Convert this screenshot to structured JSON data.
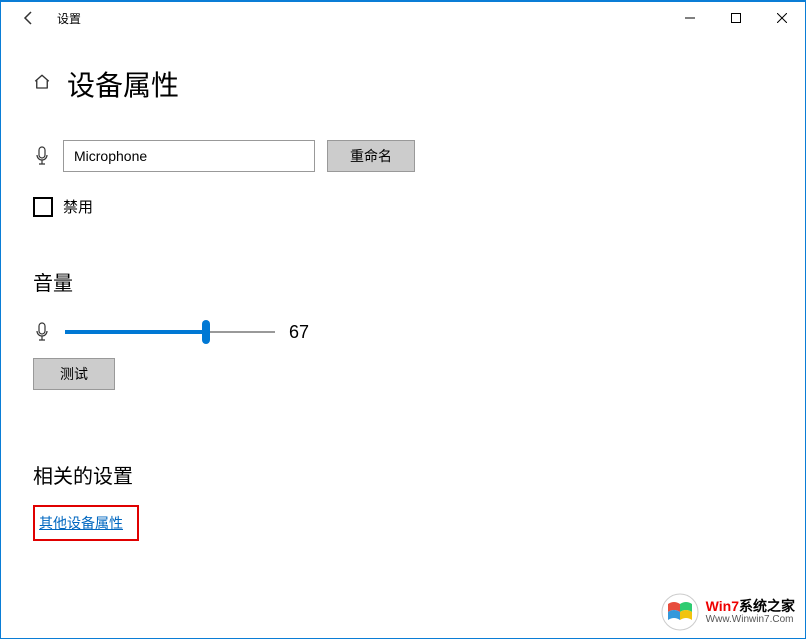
{
  "window": {
    "title": "设置"
  },
  "page": {
    "title": "设备属性"
  },
  "device": {
    "name": "Microphone",
    "rename_label": "重命名",
    "disable_label": "禁用",
    "disabled": false
  },
  "volume": {
    "section_title": "音量",
    "value": 67,
    "test_label": "测试"
  },
  "related": {
    "section_title": "相关的设置",
    "link_label": "其他设备属性"
  },
  "watermark": {
    "brand_prefix": "Win7",
    "brand_suffix": "系统之家",
    "url": "Www.Winwin7.Com"
  }
}
